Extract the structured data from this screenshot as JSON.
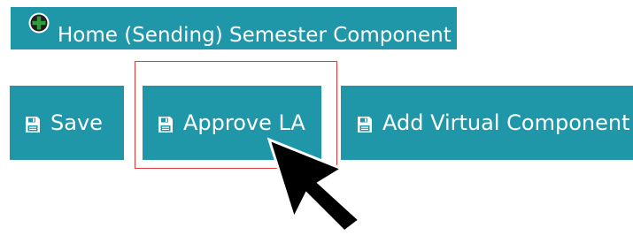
{
  "header_button": {
    "label": "Home (Sending) Semester Component",
    "icon": "plus-circle-icon"
  },
  "toolbar": {
    "save_label": "Save",
    "approve_label": "Approve LA",
    "add_virtual_label": "Add Virtual Component",
    "button_icon": "floppy-disk-icon"
  },
  "colors": {
    "button_background": "#1f97a8",
    "button_text": "#ffffff",
    "focus_outline": "#e03a3a",
    "plus_icon_green": "#2e9e3a"
  }
}
